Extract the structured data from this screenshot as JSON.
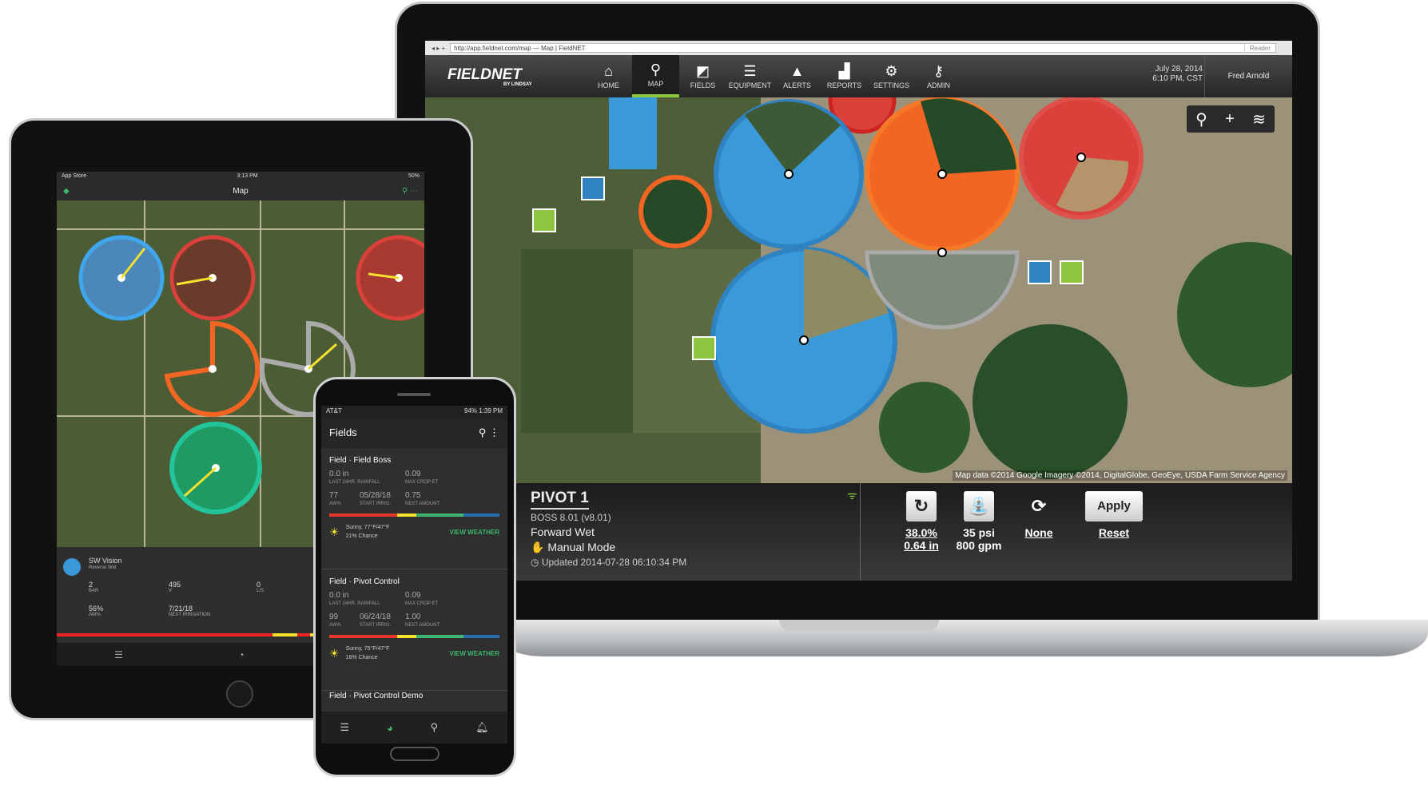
{
  "laptop": {
    "browser": {
      "url": "http://app.fieldnet.com/map",
      "title": "Map | FieldNET",
      "reader": "Reader"
    },
    "logo": {
      "name": "FIELDNET",
      "sub": "BY LINDSAY"
    },
    "nav": [
      {
        "label": "HOME",
        "icon": "home-icon"
      },
      {
        "label": "MAP",
        "icon": "map-pin-icon",
        "active": true
      },
      {
        "label": "FIELDS",
        "icon": "fields-icon"
      },
      {
        "label": "EQUIPMENT",
        "icon": "list-icon"
      },
      {
        "label": "ALERTS",
        "icon": "alert-icon"
      },
      {
        "label": "REPORTS",
        "icon": "chart-icon"
      },
      {
        "label": "SETTINGS",
        "icon": "gear-icon"
      },
      {
        "label": "ADMIN",
        "icon": "key-icon"
      }
    ],
    "date": "July 28, 2014",
    "time": "6:10 PM, CST",
    "user": "Fred Arnold",
    "map_credit": "Map data ©2014 Google Imagery ©2014, DigitalGlobe, GeoEye, USDA Farm Service Agency",
    "panel": {
      "title": "PIVOT 1",
      "firmware": "BOSS 8.01 (v8.01)",
      "direction": "Forward Wet",
      "mode": "Manual Mode",
      "updated": "Updated 2014-07-28 06:10:34 PM",
      "speed_pct": "38.0%",
      "depth": "0.64 in",
      "pressure": "35 psi",
      "flow": "800 gpm",
      "auto_reverse": "None",
      "apply": "Apply",
      "reset": "Reset"
    }
  },
  "tablet": {
    "status": {
      "left": "App Store",
      "time": "3:13 PM",
      "battery": "50%"
    },
    "title": "Map",
    "pivot": {
      "name": "SW Vision",
      "status": "Reverse Wet",
      "stats": [
        {
          "v": "2",
          "l": "BAR"
        },
        {
          "v": "495",
          "l": "V"
        },
        {
          "v": "0",
          "l": "L/S"
        },
        {
          "v": "56%",
          "l": "AW%"
        },
        {
          "v": "7/21/18",
          "l": "NEXT IRRIGATION"
        }
      ]
    }
  },
  "phone": {
    "status": {
      "carrier": "AT&T",
      "right": "94% 1:39 PM"
    },
    "title": "Fields",
    "cards": [
      {
        "title": "Field · Field Boss",
        "rain": "0.0 in",
        "rain_l": "LAST 24HR. RAINFALL",
        "et": "0.09",
        "et_l": "MAX CROP ET",
        "aw": "77",
        "aw_l": "AW%",
        "start": "05/28/18",
        "start_l": "START IRRIG.",
        "next": "0.75",
        "next_l": "NEXT AMOUNT",
        "weather": "Sunny, 77°F/47°F",
        "chance": "21% Chance",
        "view": "VIEW WEATHER"
      },
      {
        "title": "Field · Pivot Control",
        "rain": "0.0 in",
        "rain_l": "LAST 24HR. RAINFALL",
        "et": "0.09",
        "et_l": "MAX CROP ET",
        "aw": "99",
        "aw_l": "AW%",
        "start": "06/24/18",
        "start_l": "START IRRIG.",
        "next": "1.00",
        "next_l": "NEXT AMOUNT",
        "weather": "Sunny, 75°F/47°F",
        "chance": "16% Chance",
        "view": "VIEW WEATHER"
      }
    ],
    "third_card": "Field · Pivot Control Demo"
  },
  "colors": {
    "accent": "#8dc63f",
    "blue": "#3a9ad9",
    "orange": "#f26522",
    "red": "#d9413a",
    "green": "#3db66f"
  }
}
